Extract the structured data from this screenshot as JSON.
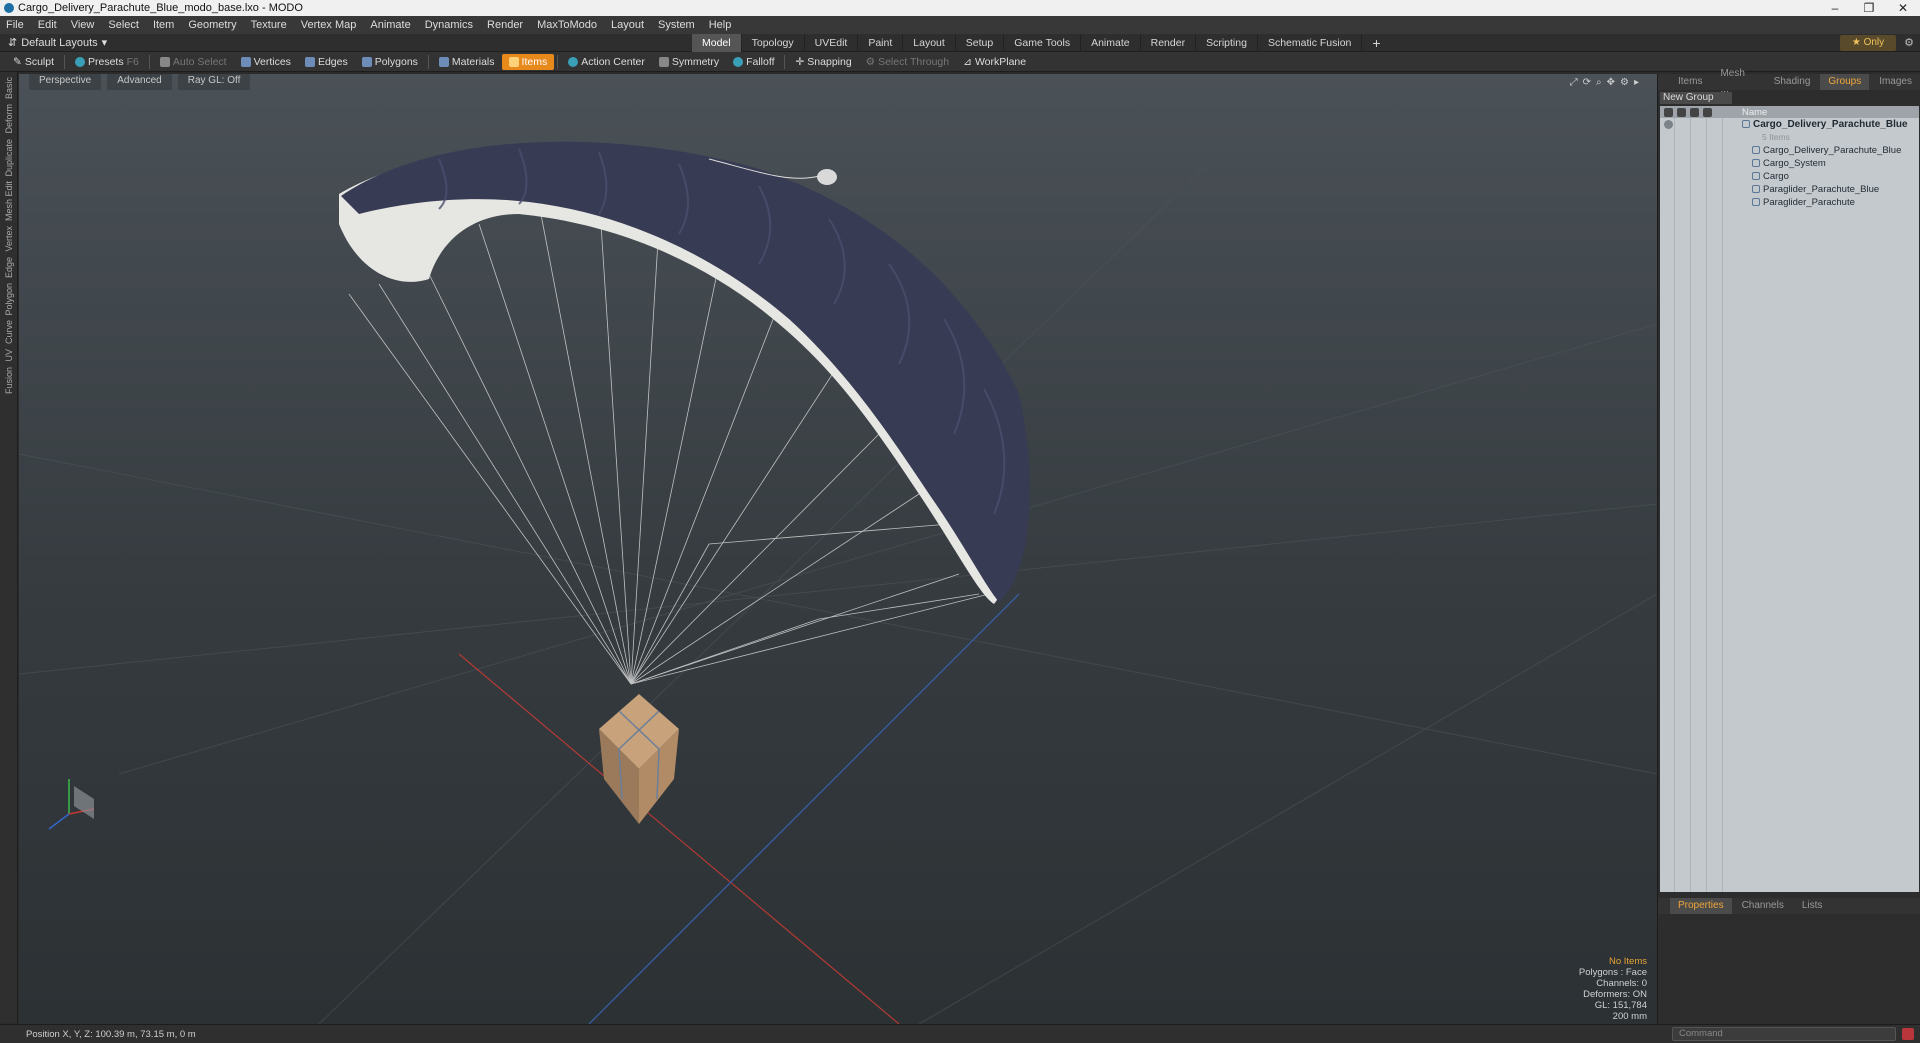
{
  "window": {
    "title": "Cargo_Delivery_Parachute_Blue_modo_base.lxo - MODO",
    "minimize": "–",
    "maximize": "❐",
    "close": "✕"
  },
  "menu": [
    "File",
    "Edit",
    "View",
    "Select",
    "Item",
    "Geometry",
    "Texture",
    "Vertex Map",
    "Animate",
    "Dynamics",
    "Render",
    "MaxToModo",
    "Layout",
    "System",
    "Help"
  ],
  "layouts": {
    "label": "Default Layouts",
    "tabs": [
      "Model",
      "Topology",
      "UVEdit",
      "Paint",
      "Layout",
      "Setup",
      "Game Tools",
      "Animate",
      "Render",
      "Scripting",
      "Schematic Fusion"
    ],
    "active_tab": "Model",
    "add": "+",
    "only_label": "Only"
  },
  "toolbar": {
    "sculpt": "Sculpt",
    "presets": "Presets",
    "presets_key": "F6",
    "auto_select": "Auto Select",
    "vertices": "Vertices",
    "edges": "Edges",
    "polygons": "Polygons",
    "materials": "Materials",
    "items": "Items",
    "action_center": "Action Center",
    "symmetry": "Symmetry",
    "falloff": "Falloff",
    "snapping": "Snapping",
    "select_through": "Select Through",
    "workplane": "WorkPlane"
  },
  "left_tabs": [
    "Basic",
    "Deform",
    "Duplicate",
    "Mesh Edit",
    "Vertex",
    "Edge",
    "Polygon",
    "Curve",
    "UV",
    "Fusion"
  ],
  "viewport": {
    "view": "Perspective",
    "shading": "Advanced",
    "raygl": "Ray GL: Off",
    "stats": {
      "items": "No Items",
      "polygons": "Polygons : Face",
      "channels": "Channels: 0",
      "deformers": "Deformers: ON",
      "gl": "GL: 151,784",
      "scale": "200 mm"
    }
  },
  "status": {
    "position": "Position X, Y, Z:  100.39 m, 73.15 m, 0 m",
    "command_placeholder": "Command"
  },
  "right_panel": {
    "tabs": [
      "Items",
      "Mesh ...",
      "Shading",
      "Groups",
      "Images"
    ],
    "active_tab": "Groups",
    "new_group": "New Group",
    "name_header": "Name",
    "tree": {
      "root": "Cargo_Delivery_Parachute_Blue",
      "root_sub": "5 Items",
      "children": [
        "Cargo_Delivery_Parachute_Blue",
        "Cargo_System",
        "Cargo",
        "Paraglider_Parachute_Blue",
        "Paraglider_Parachute"
      ]
    },
    "bottom_tabs": [
      "Properties",
      "Channels",
      "Lists"
    ],
    "bottom_active": "Properties"
  },
  "colors": {
    "accent": "#e8891c",
    "canopy_top": "#3a3d55",
    "canopy_under": "#e8e8e6",
    "viewport_bg": "#3b4246"
  }
}
